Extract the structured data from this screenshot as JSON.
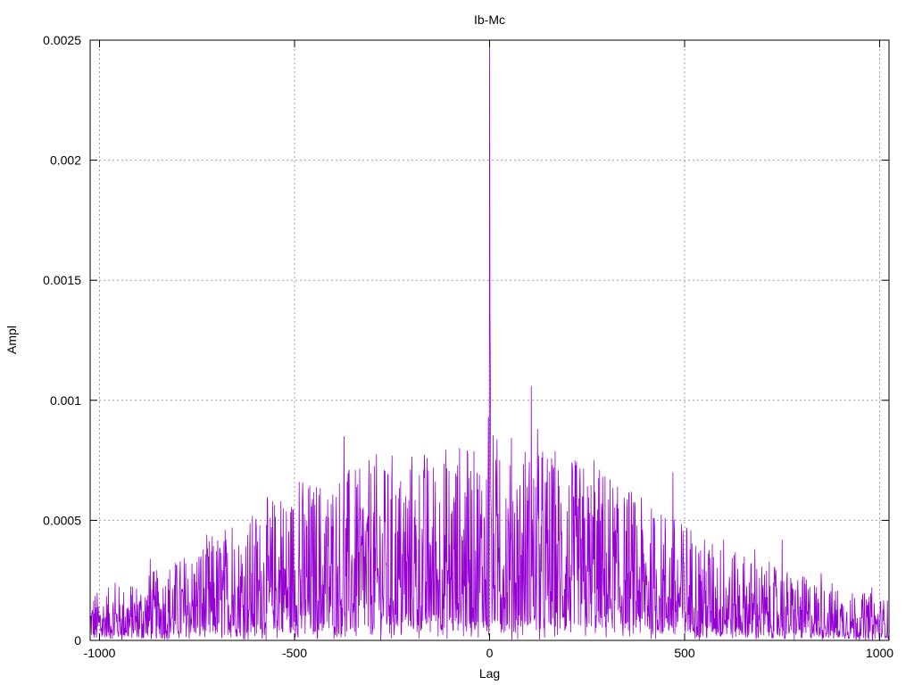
{
  "chart_data": {
    "type": "line",
    "title": "Ib-Mc",
    "xlabel": "Lag",
    "ylabel": "Ampl",
    "xlim": [
      -1024,
      1024
    ],
    "ylim": [
      0,
      0.0025
    ],
    "xticks": [
      -1000,
      -500,
      0,
      500,
      1000
    ],
    "yticks": [
      0,
      0.0005,
      0.001,
      0.0015,
      0.002,
      0.0025
    ],
    "xtick_labels": [
      "-1000",
      "-500",
      "0",
      "500",
      "1000"
    ],
    "ytick_labels": [
      "0",
      "0.0005",
      "0.001",
      "0.0015",
      "0.002",
      "0.0025"
    ],
    "grid": true,
    "line_color": "#9400d3",
    "envelope": {
      "x": [
        -1024,
        -900,
        -800,
        -700,
        -600,
        -500,
        -400,
        -300,
        -200,
        -100,
        0,
        100,
        200,
        300,
        400,
        500,
        600,
        700,
        800,
        900,
        1024
      ],
      "y": [
        8e-05,
        0.0001,
        0.00014,
        0.00018,
        0.00022,
        0.00026,
        0.00028,
        0.0003,
        0.00031,
        0.00032,
        0.00034,
        0.00033,
        0.00031,
        0.00028,
        0.00024,
        0.0002,
        0.00016,
        0.00013,
        0.00011,
        9e-05,
        7e-05
      ]
    },
    "peaks": [
      {
        "x": 0,
        "y": 0.0025
      },
      {
        "x": 1,
        "y": 0.00137
      },
      {
        "x": 2,
        "y": 0.00112
      },
      {
        "x": -3,
        "y": 0.00093
      },
      {
        "x": 107,
        "y": 0.00106
      },
      {
        "x": -373,
        "y": 0.00085
      },
      {
        "x": 123,
        "y": 0.00088
      },
      {
        "x": 26,
        "y": 0.00075
      },
      {
        "x": 268,
        "y": 0.00075
      },
      {
        "x": 165,
        "y": 0.00072
      },
      {
        "x": -270,
        "y": 0.00071
      },
      {
        "x": -338,
        "y": 0.00065
      },
      {
        "x": -200,
        "y": 0.00065
      },
      {
        "x": 470,
        "y": 0.0007
      },
      {
        "x": -488,
        "y": 0.00066
      },
      {
        "x": -535,
        "y": 0.00058
      },
      {
        "x": -660,
        "y": 0.00047
      },
      {
        "x": 505,
        "y": 0.00047
      },
      {
        "x": 750,
        "y": 0.00042
      },
      {
        "x": -870,
        "y": 0.00034
      },
      {
        "x": -60,
        "y": 0.0006
      },
      {
        "x": 60,
        "y": 0.00058
      },
      {
        "x": 330,
        "y": 0.00055
      },
      {
        "x": -140,
        "y": 0.00052
      },
      {
        "x": 215,
        "y": 0.0006
      },
      {
        "x": -420,
        "y": 0.0005
      },
      {
        "x": 600,
        "y": 0.00042
      },
      {
        "x": -600,
        "y": 0.00045
      },
      {
        "x": -740,
        "y": 0.00035
      },
      {
        "x": 680,
        "y": 0.00038
      },
      {
        "x": 850,
        "y": 0.00028
      },
      {
        "x": -960,
        "y": 0.00024
      },
      {
        "x": 980,
        "y": 0.00022
      }
    ]
  }
}
